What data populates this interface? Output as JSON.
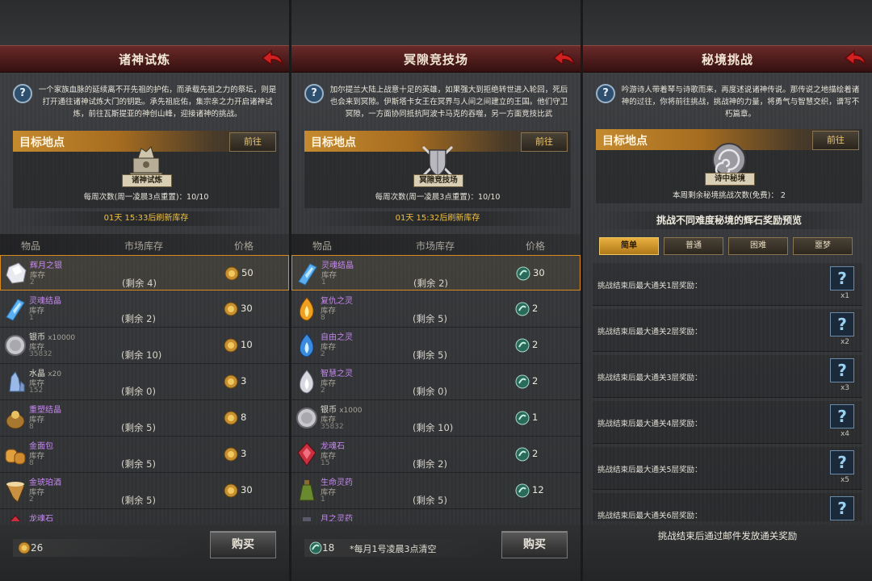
{
  "panels": [
    {
      "title": "诸神试炼",
      "description": "一个家族血脉的延续离不开先祖的护佑，而承载先祖之力的祭坛，则是打开通往诸神试炼大门的钥匙。承先祖庇佑，集宗亲之力开启诸神试炼，前往瓦斯提亚的神创山峰，迎接诸神的挑战。",
      "target_label": "目标地点",
      "go_label": "前往",
      "emblem_label": "诸神试炼",
      "weekly": "每周次数(周一凌晨3点重置)：10/10",
      "refresh": "01天 15:33后刷新库存",
      "columns": [
        "物品",
        "市场库存",
        "价格"
      ],
      "items": [
        {
          "name": "辉月之银",
          "count": "",
          "stock_label": "库存",
          "stock": "2",
          "remain": "(剩余 4)",
          "price": "50",
          "rare": true
        },
        {
          "name": "灵魂结晶",
          "count": "",
          "stock_label": "库存",
          "stock": "1",
          "remain": "(剩余 2)",
          "price": "30",
          "rare": true
        },
        {
          "name": "银币",
          "count": "x10000",
          "stock_label": "库存",
          "stock": "35832",
          "remain": "(剩余 10)",
          "price": "10",
          "rare": false
        },
        {
          "name": "水晶",
          "count": "x20",
          "stock_label": "库存",
          "stock": "152",
          "remain": "(剩余 0)",
          "price": "3",
          "rare": false
        },
        {
          "name": "重塑结晶",
          "count": "",
          "stock_label": "库存",
          "stock": "8",
          "remain": "(剩余 5)",
          "price": "8",
          "rare": true
        },
        {
          "name": "金面包",
          "count": "",
          "stock_label": "库存",
          "stock": "8",
          "remain": "(剩余 5)",
          "price": "3",
          "rare": true
        },
        {
          "name": "金琥珀酒",
          "count": "",
          "stock_label": "库存",
          "stock": "2",
          "remain": "(剩余 5)",
          "price": "30",
          "rare": true
        },
        {
          "name": "龙魂石",
          "count": "",
          "stock_label": "",
          "stock": "",
          "remain": "",
          "price": "",
          "rare": true
        }
      ],
      "balance": "26",
      "note": "",
      "buy_label": "购买"
    },
    {
      "title": "冥隙竞技场",
      "description": "加尔提兰大陆上战意十足的英雄，如果强大到拒绝转世进入轮回，死后也会来到冥隙。伊斯塔卡女王在冥界与人间之间建立的王国。他们守卫冥隙，一方面协同抵抗阿波卡马克的吞噬，另一方面竞技比武",
      "target_label": "目标地点",
      "go_label": "前往",
      "emblem_label": "冥隙竞技场",
      "weekly": "每周次数(周一凌晨3点重置)：10/10",
      "refresh": "01天 15:32后刷新库存",
      "columns": [
        "物品",
        "市场库存",
        "价格"
      ],
      "items": [
        {
          "name": "灵魂结晶",
          "count": "",
          "stock_label": "库存",
          "stock": "1",
          "remain": "(剩余 2)",
          "price": "30",
          "rare": true
        },
        {
          "name": "复仇之灵",
          "count": "",
          "stock_label": "库存",
          "stock": "8",
          "remain": "(剩余 5)",
          "price": "2",
          "rare": true
        },
        {
          "name": "自由之灵",
          "count": "",
          "stock_label": "库存",
          "stock": "2",
          "remain": "(剩余 5)",
          "price": "2",
          "rare": true
        },
        {
          "name": "智慧之灵",
          "count": "",
          "stock_label": "库存",
          "stock": "2",
          "remain": "(剩余 0)",
          "price": "2",
          "rare": true
        },
        {
          "name": "银币",
          "count": "x1000",
          "stock_label": "库存",
          "stock": "35832",
          "remain": "(剩余 10)",
          "price": "1",
          "rare": false
        },
        {
          "name": "龙魂石",
          "count": "",
          "stock_label": "库存",
          "stock": "15",
          "remain": "(剩余 2)",
          "price": "2",
          "rare": true
        },
        {
          "name": "生命灵药",
          "count": "",
          "stock_label": "库存",
          "stock": "1",
          "remain": "(剩余 5)",
          "price": "12",
          "rare": true
        },
        {
          "name": "月之灵药",
          "count": "",
          "stock_label": "",
          "stock": "",
          "remain": "",
          "price": "",
          "rare": true
        }
      ],
      "balance": "18",
      "note": "*每月1号凌晨3点清空",
      "buy_label": "购买"
    }
  ],
  "secret": {
    "title": "秘境挑战",
    "description": "吟游诗人带着琴与诗歌而来，再度述说诸神传说。那传说之地描绘着诸神的过往，你将前往挑战，挑战神的力量，将勇气与智慧交织，谱写不朽篇章。",
    "target_label": "目标地点",
    "go_label": "前往",
    "emblem_label": "诗中秘境",
    "remaining": "本周剩余秘境挑战次数(免费)： 2",
    "preview_title": "挑战不同难度秘境的辉石奖励预览",
    "tabs": [
      "简单",
      "普通",
      "困难",
      "噩梦"
    ],
    "rewards": [
      {
        "label": "挑战结束后最大通关1层奖励：",
        "qty": "x1"
      },
      {
        "label": "挑战结束后最大通关2层奖励：",
        "qty": "x2"
      },
      {
        "label": "挑战结束后最大通关3层奖励：",
        "qty": "x3"
      },
      {
        "label": "挑战结束后最大通关4层奖励：",
        "qty": "x4"
      },
      {
        "label": "挑战结束后最大通关5层奖励：",
        "qty": "x5"
      },
      {
        "label": "挑战结束后最大通关6层奖励：",
        "qty": ""
      }
    ],
    "unknown_glyph": "?",
    "footer": "挑战结束后通过邮件发放通关奖励"
  },
  "colors": {
    "accent": "#c58a2e",
    "title_bar": "#4a1a1a",
    "rare_text": "#c78af0",
    "refresh_text": "#f0c040",
    "selected_border": "#d88a20"
  },
  "icons": {
    "help": "question-icon",
    "back": "back-arrow-icon",
    "currency_1": "sun-medal-icon",
    "currency_2": "green-orb-icon"
  }
}
